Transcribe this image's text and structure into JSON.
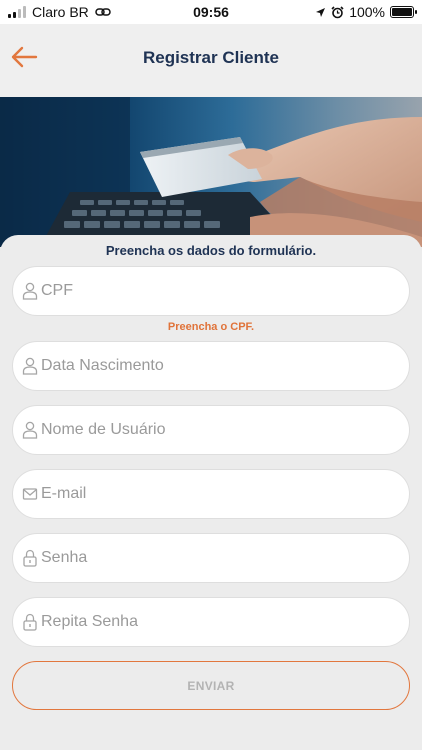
{
  "status_bar": {
    "carrier": "Claro BR",
    "time": "09:56",
    "battery": "100%",
    "battery_level": 1.0
  },
  "header": {
    "title": "Registrar Cliente",
    "back_icon": "arrow-left-icon"
  },
  "form": {
    "intro": "Preencha os dados do formulário.",
    "fields": [
      {
        "placeholder": "CPF",
        "value": "",
        "icon": "user-icon"
      },
      {
        "placeholder": "Data Nascimento",
        "value": "",
        "icon": "user-icon"
      },
      {
        "placeholder": "Nome de Usuário",
        "value": "",
        "icon": "user-icon"
      },
      {
        "placeholder": "E-mail",
        "value": "",
        "icon": "envelope-icon"
      },
      {
        "placeholder": "Senha",
        "value": "",
        "icon": "lock-icon"
      },
      {
        "placeholder": "Repita Senha",
        "value": "",
        "icon": "lock-icon"
      }
    ],
    "cpf_error": "Preencha o CPF.",
    "submit_label": "ENVIAR"
  },
  "colors": {
    "accent": "#e2773e",
    "title": "#1f3354",
    "placeholder": "#9a9a9a",
    "background": "#ececec"
  }
}
